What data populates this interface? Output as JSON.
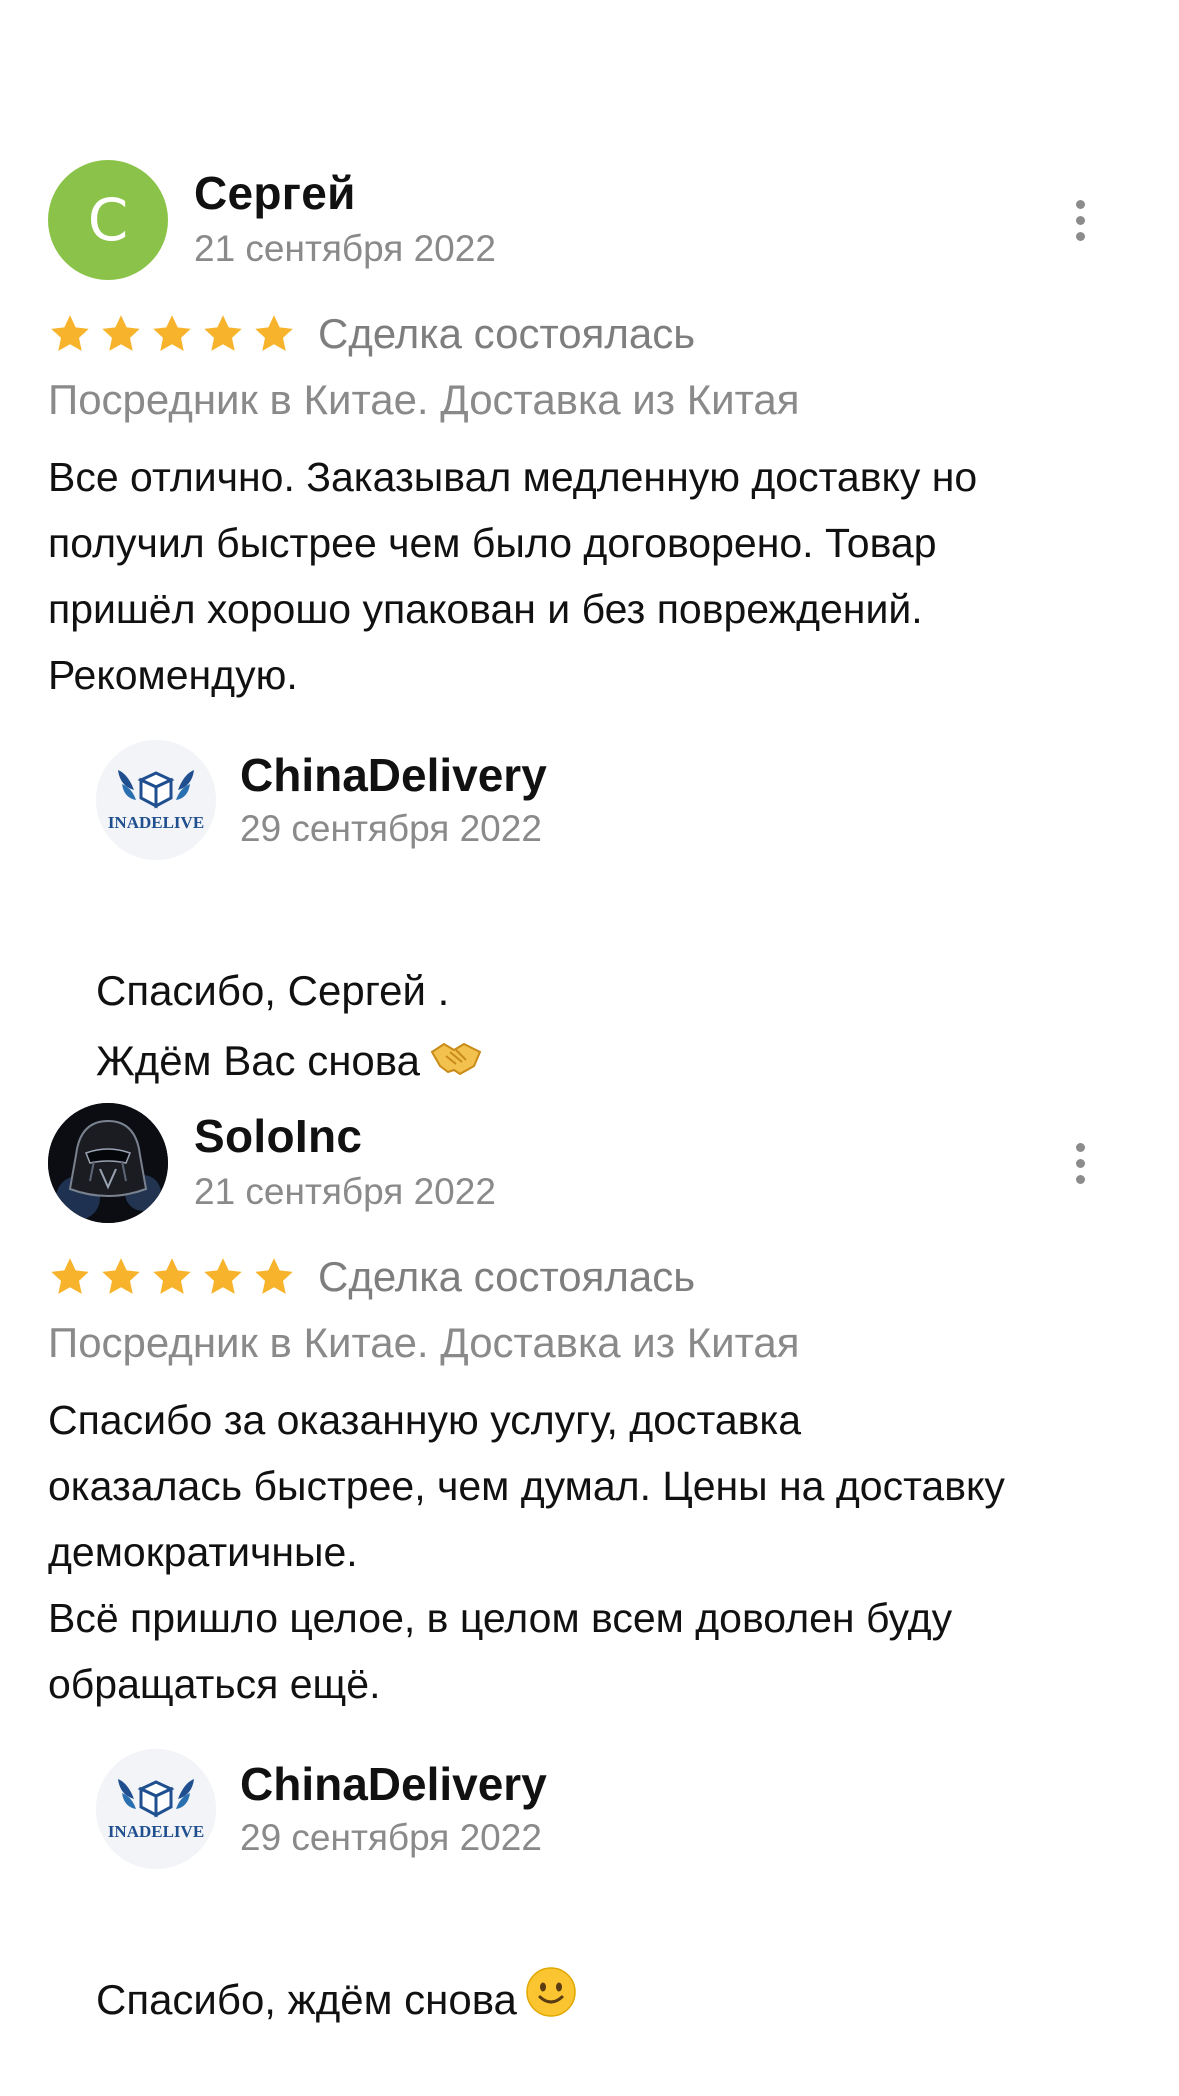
{
  "colors": {
    "star": "#f7b32b",
    "avatar_bg": "#8bc34a",
    "secondary_text": "#8a8a8a"
  },
  "reviews": [
    {
      "author": "Сергей",
      "avatar_letter": "С",
      "date": "21 сентября 2022",
      "rating": 5,
      "deal_status": "Сделка состоялась",
      "category": "Посредник в Китае. Доставка из Китая",
      "text": "Все отлично. Заказывал медленную доставку но\nполучил быстрее чем было договорено. Товар\nпришёл хорошо упакован и без повреждений.\nРекомендую.",
      "reply": {
        "author": "ChinaDelivery",
        "logo_text": "INADELIVE",
        "date": "29 сентября 2022",
        "text": "Спасибо, Сергей .\nЖдём Вас снова",
        "emoji": "handshake-icon"
      }
    },
    {
      "author": "SoloInc",
      "avatar_icon": "darth-vader-avatar",
      "date": "21 сентября 2022",
      "rating": 5,
      "deal_status": "Сделка состоялась",
      "category": "Посредник в Китае. Доставка из Китая",
      "text": "Спасибо за оказанную услугу, доставка\nоказалась быстрее, чем думал. Цены на доставку\nдемократичные.\nВсё пришло целое, в целом всем доволен буду\nобращаться ещё.",
      "reply": {
        "author": "ChinaDelivery",
        "logo_text": "INADELIVE",
        "date": "29 сентября 2022",
        "text": "Спасибо, ждём снова",
        "emoji": "smiley-icon"
      }
    }
  ]
}
